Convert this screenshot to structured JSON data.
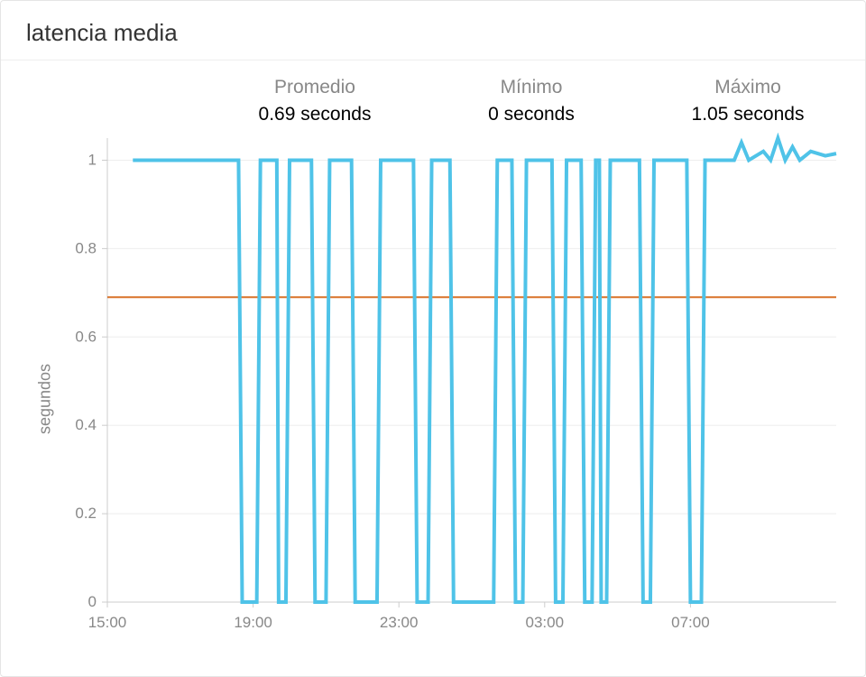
{
  "title": "latencia media",
  "stats": {
    "avg": {
      "label": "Promedio",
      "value": "0.69 seconds"
    },
    "min": {
      "label": "Mínimo",
      "value": "0 seconds"
    },
    "max": {
      "label": "Máximo",
      "value": "1.05 seconds"
    }
  },
  "chart_data": {
    "type": "line",
    "xlabel": "",
    "ylabel": "segundos",
    "ylim": [
      0,
      1.05
    ],
    "xlim": [
      15,
      35
    ],
    "y_ticks": [
      0,
      0.2,
      0.4,
      0.6,
      0.8,
      1
    ],
    "x_ticks_hours": [
      15,
      19,
      23,
      27,
      31
    ],
    "x_tick_labels": [
      "15:00",
      "19:00",
      "23:00",
      "03:00",
      "07:00"
    ],
    "average_line": 0.69,
    "series": [
      {
        "name": "latencia",
        "color": "#4fc3e8",
        "points": [
          [
            15.7,
            1.0
          ],
          [
            18.6,
            1.0
          ],
          [
            18.7,
            0.0
          ],
          [
            19.1,
            0.0
          ],
          [
            19.2,
            1.0
          ],
          [
            19.65,
            1.0
          ],
          [
            19.7,
            0.0
          ],
          [
            19.9,
            0.0
          ],
          [
            20.0,
            1.0
          ],
          [
            20.6,
            1.0
          ],
          [
            20.7,
            0.0
          ],
          [
            21.0,
            0.0
          ],
          [
            21.1,
            1.0
          ],
          [
            21.7,
            1.0
          ],
          [
            21.8,
            0.0
          ],
          [
            22.4,
            0.0
          ],
          [
            22.5,
            1.0
          ],
          [
            23.4,
            1.0
          ],
          [
            23.5,
            0.0
          ],
          [
            23.8,
            0.0
          ],
          [
            23.9,
            1.0
          ],
          [
            24.4,
            1.0
          ],
          [
            24.5,
            0.0
          ],
          [
            25.6,
            0.0
          ],
          [
            25.7,
            1.0
          ],
          [
            26.1,
            1.0
          ],
          [
            26.2,
            0.0
          ],
          [
            26.4,
            0.0
          ],
          [
            26.5,
            1.0
          ],
          [
            27.2,
            1.0
          ],
          [
            27.3,
            0.0
          ],
          [
            27.5,
            0.0
          ],
          [
            27.6,
            1.0
          ],
          [
            28.0,
            1.0
          ],
          [
            28.1,
            0.0
          ],
          [
            28.3,
            0.0
          ],
          [
            28.4,
            1.0
          ],
          [
            28.5,
            1.0
          ],
          [
            28.55,
            0.0
          ],
          [
            28.7,
            0.0
          ],
          [
            28.8,
            1.0
          ],
          [
            29.6,
            1.0
          ],
          [
            29.7,
            0.0
          ],
          [
            29.9,
            0.0
          ],
          [
            30.0,
            1.0
          ],
          [
            30.9,
            1.0
          ],
          [
            31.0,
            0.0
          ],
          [
            31.3,
            0.0
          ],
          [
            31.4,
            1.0
          ],
          [
            32.2,
            1.0
          ],
          [
            32.4,
            1.04
          ],
          [
            32.6,
            1.0
          ],
          [
            32.8,
            1.01
          ],
          [
            33.0,
            1.02
          ],
          [
            33.2,
            1.0
          ],
          [
            33.4,
            1.05
          ],
          [
            33.6,
            1.0
          ],
          [
            33.8,
            1.03
          ],
          [
            34.0,
            1.0
          ],
          [
            34.3,
            1.02
          ],
          [
            34.7,
            1.01
          ],
          [
            35.0,
            1.015
          ]
        ]
      }
    ]
  }
}
